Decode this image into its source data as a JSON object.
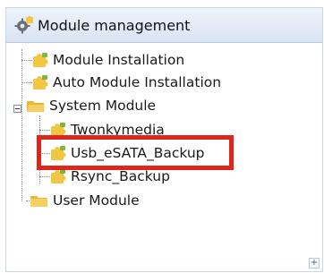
{
  "header": {
    "title": "Module management",
    "icon": "gear-puzzle-icon"
  },
  "tree": {
    "items": [
      {
        "label": "Module Installation",
        "icon": "puzzle-icon"
      },
      {
        "label": "Auto Module Installation",
        "icon": "puzzle-icon"
      },
      {
        "label": "System Module",
        "icon": "folder-open-icon",
        "expanded": true
      },
      {
        "label": "Twonkymedia",
        "icon": "puzzle-icon"
      },
      {
        "label": "Usb_eSATA_Backup",
        "icon": "puzzle-icon",
        "selected": true
      },
      {
        "label": "Rsync_Backup",
        "icon": "puzzle-icon"
      },
      {
        "label": "User Module",
        "icon": "folder-icon"
      }
    ]
  },
  "colors": {
    "highlight": "#e0251b",
    "header_bg": "#d9e4f3",
    "folder": "#f2c542",
    "puzzle": "#f2c542",
    "puzzle_green": "#7bb93d"
  }
}
